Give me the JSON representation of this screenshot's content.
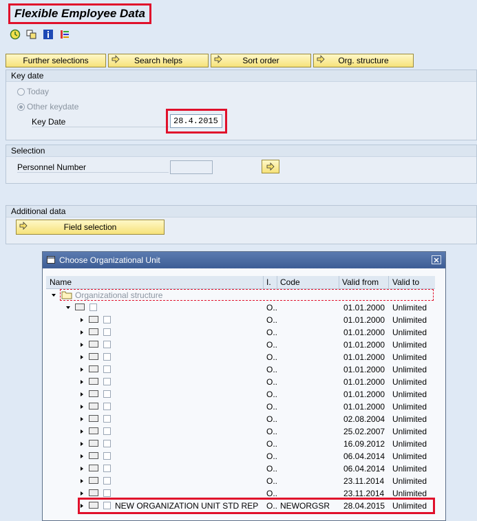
{
  "app": {
    "title": "Flexible Employee Data"
  },
  "toolbar": {
    "icons": [
      "execute-icon",
      "copy-variant-icon",
      "info-icon",
      "selection-options-icon"
    ]
  },
  "tabs": [
    {
      "label": "Further selections"
    },
    {
      "label": "Search helps"
    },
    {
      "label": "Sort order"
    },
    {
      "label": "Org. structure"
    }
  ],
  "key_date_group": {
    "title": "Key date",
    "today_label": "Today",
    "other_label": "Other keydate",
    "key_date_label": "Key Date",
    "key_date_value": "28.4.2015"
  },
  "selection_group": {
    "title": "Selection",
    "personnel_number_label": "Personnel Number",
    "personnel_number_value": ""
  },
  "additional_group": {
    "title": "Additional data",
    "field_selection_label": "Field selection"
  },
  "dialog": {
    "title": "Choose Organizational Unit",
    "columns": {
      "name": "Name",
      "i": "I.",
      "code": "Code",
      "valid_from": "Valid from",
      "valid_to": "Valid to"
    },
    "root_label": "Organizational structure",
    "rows": [
      {
        "i": "O..",
        "code": "",
        "from": "01.01.2000",
        "to": "Unlimited"
      },
      {
        "i": "O..",
        "code": "",
        "from": "01.01.2000",
        "to": "Unlimited"
      },
      {
        "i": "O..",
        "code": "",
        "from": "01.01.2000",
        "to": "Unlimited"
      },
      {
        "i": "O..",
        "code": "",
        "from": "01.01.2000",
        "to": "Unlimited"
      },
      {
        "i": "O..",
        "code": "",
        "from": "01.01.2000",
        "to": "Unlimited"
      },
      {
        "i": "O..",
        "code": "",
        "from": "01.01.2000",
        "to": "Unlimited"
      },
      {
        "i": "O..",
        "code": "",
        "from": "01.01.2000",
        "to": "Unlimited"
      },
      {
        "i": "O..",
        "code": "",
        "from": "01.01.2000",
        "to": "Unlimited"
      },
      {
        "i": "O..",
        "code": "",
        "from": "01.01.2000",
        "to": "Unlimited"
      },
      {
        "i": "O..",
        "code": "",
        "from": "02.08.2004",
        "to": "Unlimited"
      },
      {
        "i": "O..",
        "code": "",
        "from": "25.02.2007",
        "to": "Unlimited"
      },
      {
        "i": "O..",
        "code": "",
        "from": "16.09.2012",
        "to": "Unlimited"
      },
      {
        "i": "O..",
        "code": "",
        "from": "06.04.2014",
        "to": "Unlimited"
      },
      {
        "i": "O..",
        "code": "",
        "from": "06.04.2014",
        "to": "Unlimited"
      },
      {
        "i": "O..",
        "code": "",
        "from": "23.11.2014",
        "to": "Unlimited"
      },
      {
        "i": "O..",
        "code": "",
        "from": "23.11.2014",
        "to": "Unlimited"
      }
    ],
    "new_row": {
      "name": "NEW ORGANIZATION UNIT STD REP",
      "i": "O..",
      "code": "NEWORGSR",
      "from": "28.04.2015",
      "to": "Unlimited"
    }
  },
  "colors": {
    "highlight": "#e0102b",
    "button_yellow": "#f6e27a",
    "dialog_header": "#3d5d95"
  }
}
